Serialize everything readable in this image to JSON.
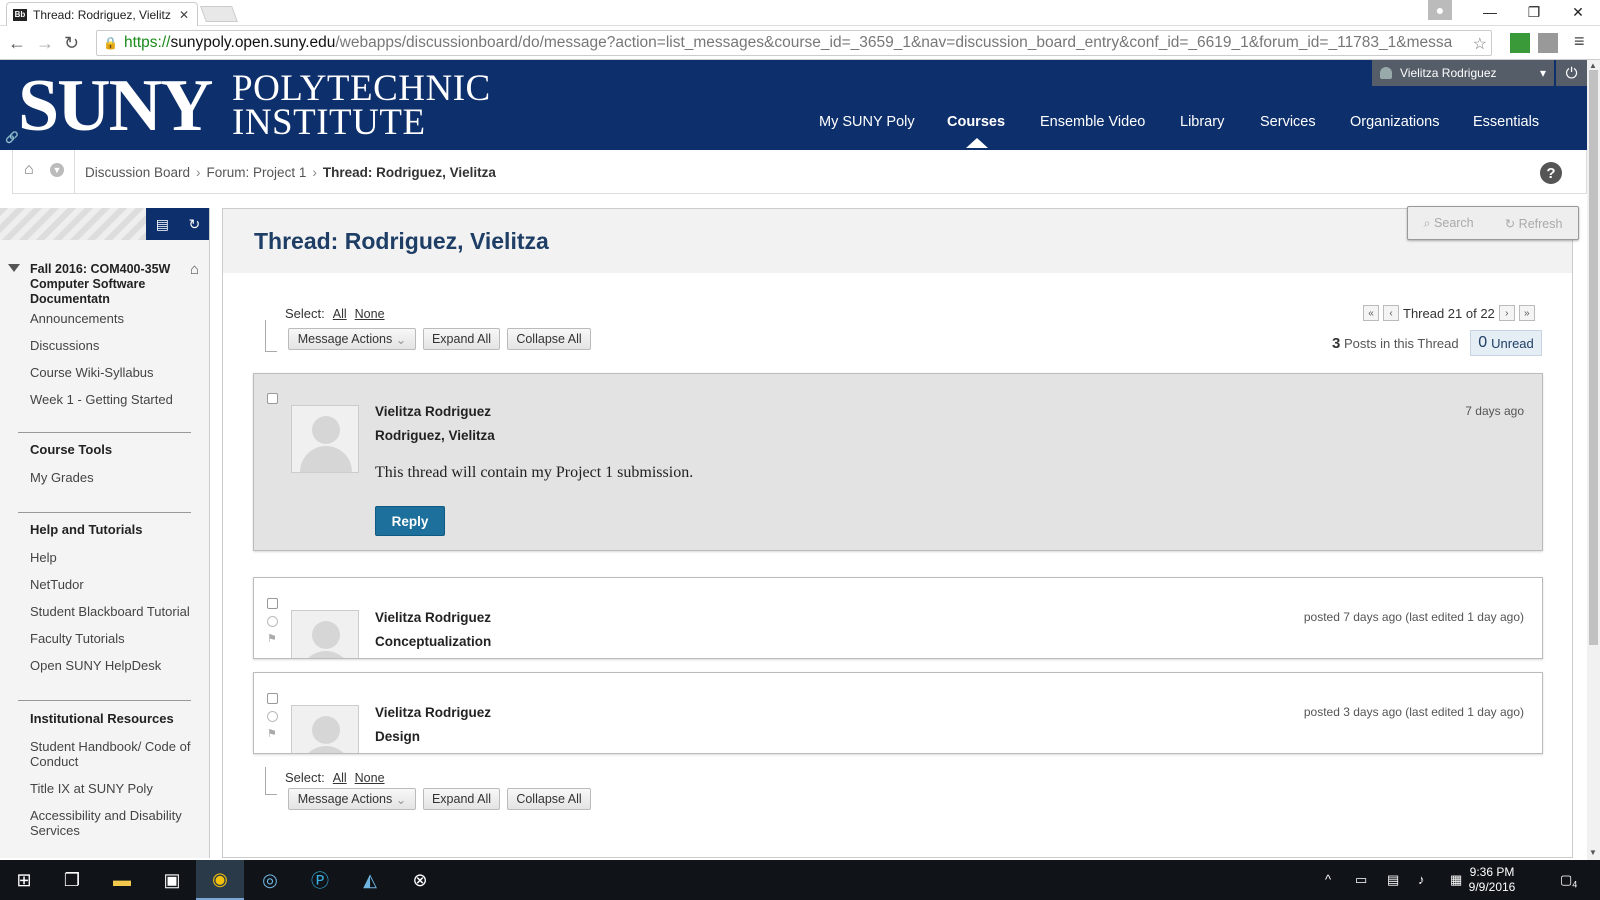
{
  "browser": {
    "tab_title": "Thread: Rodriguez, Vielitz",
    "tab_favicon": "Bb",
    "url_proto": "https://",
    "url_host": "sunypoly.open.suny.edu",
    "url_rest": "/webapps/discussionboard/do/message?action=list_messages&course_id=_3659_1&nav=discussion_board_entry&conf_id=_6619_1&forum_id=_11783_1&messa"
  },
  "header": {
    "logo_main": "SUNY",
    "logo_line1": "POLYTECHNIC",
    "logo_line2": "INSTITUTE",
    "user_name": "Vielitza Rodriguez",
    "nav": [
      "My SUNY Poly",
      "Courses",
      "Ensemble Video",
      "Library",
      "Services",
      "Organizations",
      "Essentials"
    ],
    "active_nav": "Courses",
    "brand_color": "#0d2f6b"
  },
  "breadcrumb": {
    "items": [
      "Discussion Board",
      "Forum: Project 1"
    ],
    "current": "Thread: Rodriguez, Vielitza"
  },
  "leftmenu": {
    "course_title": "Fall 2016: COM400-35W Computer Software Documentatn",
    "course_links": [
      "Announcements",
      "Discussions",
      "Course Wiki-Syllabus",
      "Week 1 - Getting Started"
    ],
    "tools_heading": "Course Tools",
    "tools_links": [
      "My Grades"
    ],
    "help_heading": "Help and Tutorials",
    "help_links": [
      "Help",
      "NetTudor",
      "Student Blackboard Tutorial",
      "Faculty Tutorials",
      "Open SUNY HelpDesk"
    ],
    "inst_heading": "Institutional Resources",
    "inst_links": [
      "Student Handbook/ Code of Conduct",
      "Title IX at SUNY Poly",
      "Accessibility and Disability Services"
    ]
  },
  "main": {
    "title": "Thread: Rodriguez, Vielitza",
    "search_label": "Search",
    "refresh_label": "Refresh",
    "select_label": "Select:",
    "select_all": "All",
    "select_none": "None",
    "message_actions": "Message Actions",
    "expand_all": "Expand All",
    "collapse_all": "Collapse All",
    "pager_text": "Thread 21 of 22",
    "posts_count": "3",
    "posts_label": "Posts in this Thread",
    "unread_count": "0",
    "unread_label": "Unread",
    "reply_label": "Reply"
  },
  "messages": [
    {
      "author": "Vielitza Rodriguez",
      "subject": "Rodriguez, Vielitza",
      "when": "7 days ago",
      "body": "This thread will contain my Project 1 submission."
    },
    {
      "author": "Vielitza Rodriguez",
      "subject": "Conceptualization",
      "when": "posted 7 days ago (last edited 1 day ago)"
    },
    {
      "author": "Vielitza Rodriguez",
      "subject": "Design",
      "when": "posted 3 days ago (last edited 1 day ago)"
    }
  ],
  "taskbar": {
    "time": "9:36 PM",
    "date": "9/9/2016",
    "notifications": "4"
  }
}
